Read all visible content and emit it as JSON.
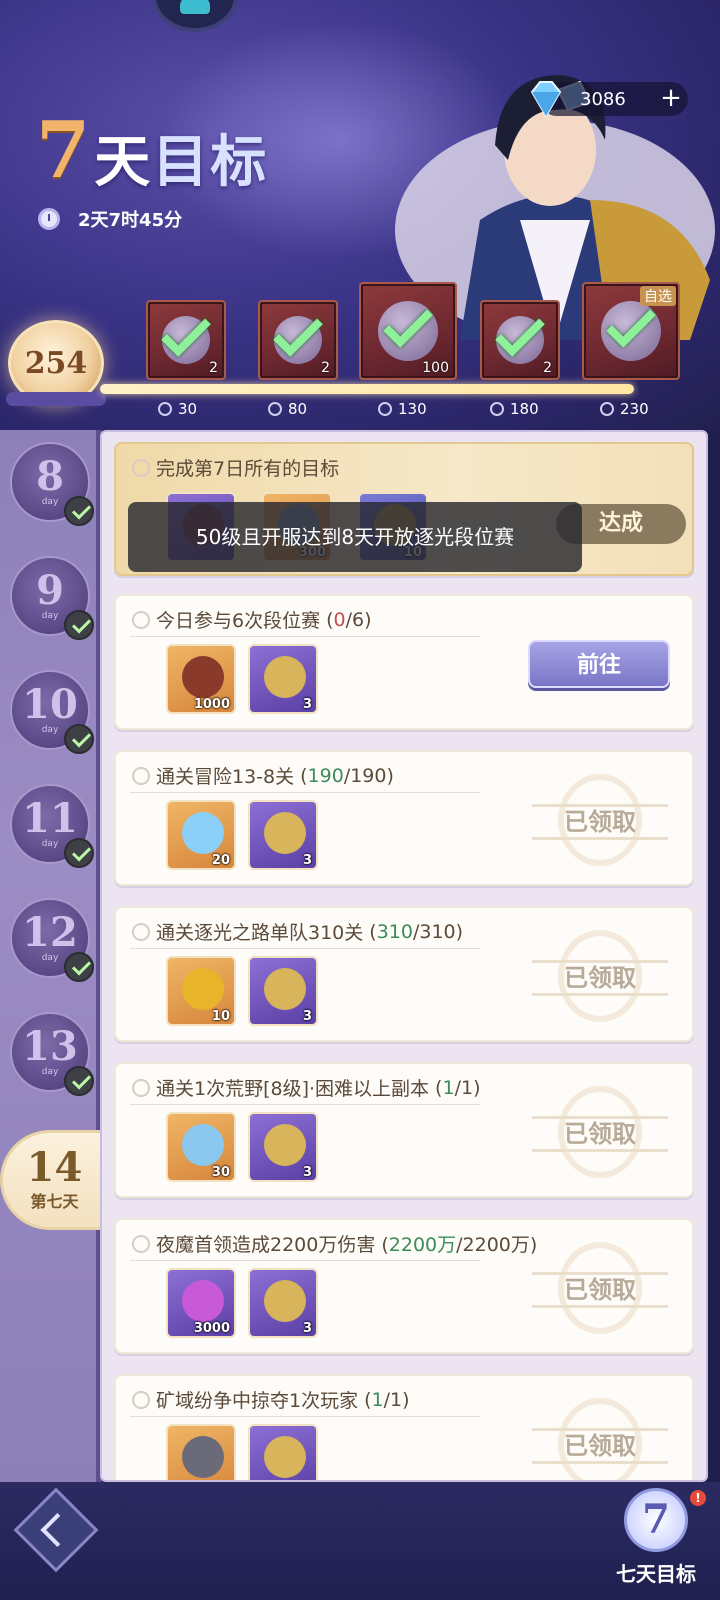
{
  "event": {
    "title_number": "7",
    "title_text_1": "天",
    "title_text_2": "目标",
    "timer": "2天7时45分"
  },
  "currency": {
    "value": "3086",
    "add_symbol": "+"
  },
  "milestones": {
    "score": "254",
    "rewards": [
      {
        "threshold": "30",
        "qty": "2",
        "claimed": true
      },
      {
        "threshold": "80",
        "qty": "2",
        "claimed": true
      },
      {
        "threshold": "130",
        "qty": "100",
        "claimed": true
      },
      {
        "threshold": "180",
        "qty": "2",
        "claimed": true
      },
      {
        "threshold": "230",
        "qty": "",
        "tag": "自选",
        "claimed": true
      }
    ]
  },
  "days": [
    {
      "num": "8",
      "sub": "day",
      "done": true
    },
    {
      "num": "9",
      "sub": "day",
      "done": true
    },
    {
      "num": "10",
      "sub": "day",
      "done": true
    },
    {
      "num": "11",
      "sub": "day",
      "done": true
    },
    {
      "num": "12",
      "sub": "day",
      "done": true
    },
    {
      "num": "13",
      "sub": "day",
      "done": true
    },
    {
      "num": "14",
      "sub": "第七天",
      "active": true
    }
  ],
  "final_task": {
    "title": "完成第7日所有的目标",
    "reward_counts": [
      "",
      "300",
      "10"
    ],
    "button": "达成"
  },
  "toast": "50级且开服达到8天开放逐光段位赛",
  "tasks": [
    {
      "title": "今日参与6次段位赛",
      "cur": "0",
      "total": "6",
      "state": "todo",
      "rewards": [
        {
          "cnt": "1000",
          "color": "orange"
        },
        {
          "cnt": "3",
          "color": "purple"
        }
      ],
      "action": "前往"
    },
    {
      "title": "通关冒险13-8关",
      "cur": "190",
      "total": "190",
      "state": "done",
      "rewards": [
        {
          "cnt": "20",
          "color": "orange"
        },
        {
          "cnt": "3",
          "color": "purple"
        }
      ],
      "action": "已领取"
    },
    {
      "title": "通关逐光之路单队310关",
      "cur": "310",
      "total": "310",
      "state": "done",
      "rewards": [
        {
          "cnt": "10",
          "color": "orange"
        },
        {
          "cnt": "3",
          "color": "purple"
        }
      ],
      "action": "已领取"
    },
    {
      "title": "通关1次荒野[8级]·困难以上副本",
      "cur": "1",
      "total": "1",
      "state": "done",
      "rewards": [
        {
          "cnt": "30",
          "color": "orange"
        },
        {
          "cnt": "3",
          "color": "purple"
        }
      ],
      "action": "已领取"
    },
    {
      "title": "夜魔首领造成2200万伤害",
      "cur": "2200万",
      "total": "2200万",
      "state": "done",
      "rewards": [
        {
          "cnt": "3000",
          "color": "purple"
        },
        {
          "cnt": "3",
          "color": "purple"
        }
      ],
      "action": "已领取"
    },
    {
      "title": "矿域纷争中掠夺1次玩家",
      "cur": "1",
      "total": "1",
      "state": "done",
      "rewards": [
        {
          "cnt": "",
          "color": "orange"
        },
        {
          "cnt": "",
          "color": "purple"
        }
      ],
      "action": "已领取"
    }
  ],
  "bottom": {
    "seven_number": "7",
    "seven_label": "七天目标",
    "notify": "!"
  },
  "colors": {
    "header_bg": "#3a3386",
    "done_progress": "#3e8a5a",
    "todo_progress": "#c05050",
    "accent_gold": "#f2b46a"
  }
}
